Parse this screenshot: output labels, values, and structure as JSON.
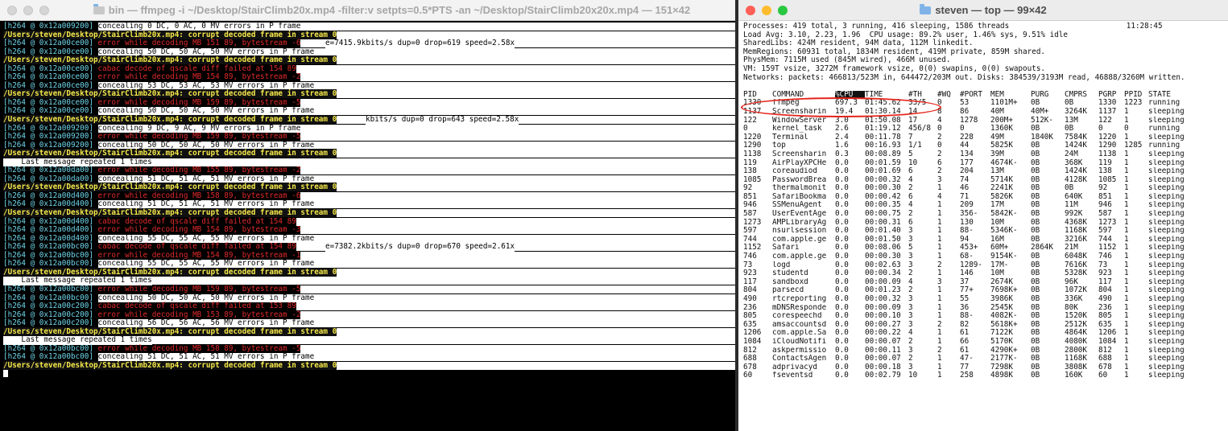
{
  "left_window": {
    "title": "bin — ffmpeg -i ~/Desktop/StairClimb20x.mp4 -filter:v setpts=0.5*PTS -an ~/Desktop/StairClimb20x20x.mp4 — 151×42",
    "lines": [
      {
        "p": "[h264 @ 0x12a009200] ",
        "t": "concealing 0 DC, 0 AC, 0 MV errors in P frame",
        "k": "info",
        "w": 290
      },
      {
        "t": "/Users/steven/Desktop/StairClimb20x.mp4: corrupt decoded frame in stream 0",
        "k": "path",
        "w": 450
      },
      {
        "p": "[h264 @ 0x12a00ce00] ",
        "t": "error while decoding MB 151 89, bytestream -6",
        "k": "err",
        "w": 270,
        "stats": "e=7415.9kbits/s dup=0 drop=619 speed=2.58x"
      },
      {
        "p": "[h264 @ 0x12a00ce00] ",
        "t": "concealing 50 DC, 50 AC, 50 MV errors in P frame",
        "k": "info",
        "w": 290
      },
      {
        "t": "/Users/steven/Desktop/StairClimb20x.mp4: corrupt decoded frame in stream 0",
        "k": "path",
        "w": 450
      },
      {
        "p": "[h264 @ 0x12a00ce00] ",
        "t": "cabac decode of qscale diff failed at 154 89",
        "k": "err",
        "w": 290
      },
      {
        "p": "[h264 @ 0x12a00ce00] ",
        "t": "error while decoding MB 154 89, bytestream -2",
        "k": "err",
        "w": 290
      },
      {
        "p": "[h264 @ 0x12a00ce00] ",
        "t": "concealing 53 DC, 53 AC, 53 MV errors in P frame",
        "k": "info",
        "w": 290
      },
      {
        "t": "/Users/steven/Desktop/StairClimb20x.mp4: corrupt decoded frame in stream 0",
        "k": "path",
        "w": 450
      },
      {
        "p": "[h264 @ 0x12a00ce00] ",
        "t": "error while decoding MB 159 89, bytestream -5",
        "k": "err",
        "w": 290
      },
      {
        "p": "[h264 @ 0x12a00ce00] ",
        "t": "concealing 50 DC, 50 AC, 50 MV errors in P frame",
        "k": "info",
        "w": 290
      },
      {
        "t": "/Users/steven/Desktop/StairClimb20x.mp4: corrupt decoded frame in stream 0",
        "k": "path",
        "w": 450,
        "stats": "kbits/s dup=0 drop=643 speed=2.58x"
      },
      {
        "p": "[h264 @ 0x12a009200] ",
        "t": "concealing 9 DC, 9 AC, 9 MV errors in P frame",
        "k": "info",
        "w": 290
      },
      {
        "p": "[h264 @ 0x12a009200] ",
        "t": "error while decoding MB 159 89, bytestream -5",
        "k": "err",
        "w": 290
      },
      {
        "p": "[h264 @ 0x12a009200] ",
        "t": "concealing 50 DC, 50 AC, 50 MV errors in P frame",
        "k": "info",
        "w": 290
      },
      {
        "t": "/Users/steven/Desktop/StairClimb20x.mp4: corrupt decoded frame in stream 0",
        "k": "path",
        "w": 450
      },
      {
        "t": "    Last message repeated 1 times",
        "k": "rep",
        "w": 200
      },
      {
        "p": "[h264 @ 0x12a00da00] ",
        "t": "error while decoding MB 155 89, bytestream -2",
        "k": "err",
        "w": 290
      },
      {
        "p": "[h264 @ 0x12a00da00] ",
        "t": "concealing 51 DC, 51 AC, 51 MV errors in P frame",
        "k": "info",
        "w": 290
      },
      {
        "t": "/Users/steven/Desktop/StairClimb20x.mp4: corrupt decoded frame in stream 0",
        "k": "path",
        "w": 450
      },
      {
        "p": "[h264 @ 0x12a00d400] ",
        "t": "error while decoding MB 158 89, bytestream -6",
        "k": "err",
        "w": 290
      },
      {
        "p": "[h264 @ 0x12a00d400] ",
        "t": "concealing 51 DC, 51 AC, 51 MV errors in P frame",
        "k": "info",
        "w": 290
      },
      {
        "t": "/Users/steven/Desktop/StairClimb20x.mp4: corrupt decoded frame in stream 0",
        "k": "path",
        "w": 450
      },
      {
        "p": "[h264 @ 0x12a00d400] ",
        "t": "cabac decode of qscale diff failed at 154 89",
        "k": "err",
        "w": 290
      },
      {
        "p": "[h264 @ 0x12a00d400] ",
        "t": "error while decoding MB 154 89, bytestream -3",
        "k": "err",
        "w": 290
      },
      {
        "p": "[h264 @ 0x12a00d400] ",
        "t": "concealing 55 DC, 55 AC, 55 MV errors in P frame",
        "k": "info",
        "w": 290
      },
      {
        "p": "[h264 @ 0x12a00bc00] ",
        "t": "cabac decode of qscale diff failed at 154 89",
        "k": "err",
        "w": 290,
        "stats": "e=7382.2kbits/s dup=0 drop=670 speed=2.61x"
      },
      {
        "p": "[h264 @ 0x12a00bc00] ",
        "t": "error while decoding MB 154 89, bytestream -1",
        "k": "err",
        "w": 290
      },
      {
        "p": "[h264 @ 0x12a00bc00] ",
        "t": "concealing 55 DC, 55 AC, 55 MV errors in P frame",
        "k": "info",
        "w": 290
      },
      {
        "t": "/Users/steven/Desktop/StairClimb20x.mp4: corrupt decoded frame in stream 0",
        "k": "path",
        "w": 450
      },
      {
        "t": "    Last message repeated 1 times",
        "k": "rep",
        "w": 200
      },
      {
        "p": "[h264 @ 0x12a00bc00] ",
        "t": "error while decoding MB 159 89, bytestream -5",
        "k": "err",
        "w": 290
      },
      {
        "p": "[h264 @ 0x12a00bc00] ",
        "t": "concealing 50 DC, 50 AC, 50 MV errors in P frame",
        "k": "info",
        "w": 290
      },
      {
        "p": "[h264 @ 0x12a00c200] ",
        "t": "cabac decode of qscale diff failed at 153 89",
        "k": "err",
        "w": 290
      },
      {
        "p": "[h264 @ 0x12a00c200] ",
        "t": "error while decoding MB 153 89, bytestream -2",
        "k": "err",
        "w": 290
      },
      {
        "p": "[h264 @ 0x12a00c200] ",
        "t": "concealing 56 DC, 56 AC, 56 MV errors in P frame",
        "k": "info",
        "w": 290
      },
      {
        "t": "/Users/steven/Desktop/StairClimb20x.mp4: corrupt decoded frame in stream 0",
        "k": "path",
        "w": 450
      },
      {
        "t": "    Last message repeated 1 times",
        "k": "rep",
        "w": 200
      },
      {
        "p": "[h264 @ 0x12a00bc00] ",
        "t": "error while decoding MB 158 89, bytestream -5",
        "k": "err",
        "w": 290
      },
      {
        "p": "[h264 @ 0x12a00bc00] ",
        "t": "concealing 51 DC, 51 AC, 51 MV errors in P frame",
        "k": "info",
        "w": 290
      },
      {
        "t": "/Users/steven/Desktop/StairClimb20x.mp4: corrupt decoded frame in stream 0",
        "k": "path",
        "w": 450
      }
    ]
  },
  "right_window": {
    "title": "steven — top — 99×42",
    "summary": [
      "Processes: 419 total, 3 running, 416 sleeping, 1586 threads                          11:28:45",
      "Load Avg: 3.10, 2.23, 1.96  CPU usage: 89.2% user, 1.46% sys, 9.51% idle",
      "SharedLibs: 424M resident, 94M data, 112M linkedit.",
      "MemRegions: 60931 total, 1834M resident, 419M private, 859M shared.",
      "PhysMem: 7115M used (845M wired), 466M unused.",
      "VM: 159T vsize, 3272M framework vsize, 0(0) swapins, 0(0) swapouts.",
      "Networks: packets: 466813/523M in, 644472/203M out. Disks: 384539/3193M read, 46888/3260M written."
    ],
    "columns": [
      "PID",
      "COMMAND",
      "%CPU",
      "TIME",
      "#TH",
      "#WQ",
      "#PORT",
      "MEM",
      "PURG",
      "CMPRS",
      "PGRP",
      "PPID",
      "STATE"
    ],
    "rows": [
      [
        "1330",
        "ffmpeg",
        "697.3",
        "01:45.62",
        "33/5",
        "0",
        "53",
        "1101M+",
        "0B",
        "0B",
        "1330",
        "1223",
        "running"
      ],
      [
        "1137",
        "Screensharin",
        "19.4",
        "01:30.14",
        "14",
        "8",
        "86",
        "40M",
        "40M+",
        "3264K",
        "1137",
        "1",
        "sleeping"
      ],
      [
        "122",
        "WindowServer",
        "3.0",
        "01:50.08",
        "17",
        "4",
        "1278",
        "200M+",
        "512K-",
        "13M",
        "122",
        "1",
        "sleeping"
      ],
      [
        "0",
        "kernel_task",
        "2.6",
        "01:19.12",
        "456/8",
        "0",
        "0",
        "1360K",
        "0B",
        "0B",
        "0",
        "0",
        "running"
      ],
      [
        "1220",
        "Terminal",
        "2.4",
        "00:11.78",
        "7",
        "2",
        "228",
        "49M",
        "1840K",
        "7584K",
        "1220",
        "1",
        "sleeping"
      ],
      [
        "1290",
        "top",
        "1.6",
        "00:16.93",
        "1/1",
        "0",
        "44",
        "5825K",
        "0B",
        "1424K",
        "1290",
        "1285",
        "running"
      ],
      [
        "1138",
        "Screensharin",
        "0.3",
        "00:08.89",
        "5",
        "2",
        "134",
        "39M",
        "0B",
        "24M",
        "1138",
        "1",
        "sleeping"
      ],
      [
        "119",
        "AirPlayXPCHe",
        "0.0",
        "00:01.59",
        "10",
        "6",
        "177",
        "4674K-",
        "0B",
        "368K",
        "119",
        "1",
        "sleeping"
      ],
      [
        "138",
        "coreaudiod",
        "0.0",
        "00:01.69",
        "6",
        "2",
        "204",
        "13M",
        "0B",
        "1424K",
        "138",
        "1",
        "sleeping"
      ],
      [
        "1085",
        "PasswordBrea",
        "0.0",
        "00:00.32",
        "4",
        "3",
        "74",
        "5714K",
        "0B",
        "4128K",
        "1085",
        "1",
        "sleeping"
      ],
      [
        "92",
        "thermalmonit",
        "0.0",
        "00:00.30",
        "2",
        "1",
        "46",
        "2241K",
        "0B",
        "0B",
        "92",
        "1",
        "sleeping"
      ],
      [
        "851",
        "SafariBookma",
        "0.0",
        "00:00.42",
        "6",
        "4",
        "71",
        "5826K",
        "0B",
        "640K",
        "851",
        "1",
        "sleeping"
      ],
      [
        "946",
        "SSMenuAgent",
        "0.0",
        "00:00.35",
        "4",
        "1",
        "209",
        "17M",
        "0B",
        "11M",
        "946",
        "1",
        "sleeping"
      ],
      [
        "587",
        "UserEventAge",
        "0.0",
        "00:00.75",
        "2",
        "1",
        "356-",
        "5842K-",
        "0B",
        "992K",
        "587",
        "1",
        "sleeping"
      ],
      [
        "1273",
        "AMPLibraryAg",
        "0.0",
        "00:00.31",
        "6",
        "1",
        "130",
        "10M",
        "0B",
        "4368K",
        "1273",
        "1",
        "sleeping"
      ],
      [
        "597",
        "nsurlsession",
        "0.0",
        "00:01.40",
        "3",
        "1",
        "88-",
        "5346K-",
        "0B",
        "1168K",
        "597",
        "1",
        "sleeping"
      ],
      [
        "744",
        "com.apple.ge",
        "0.0",
        "00:01.50",
        "3",
        "1",
        "94",
        "16M",
        "0B",
        "3216K",
        "744",
        "1",
        "sleeping"
      ],
      [
        "1152",
        "Safari",
        "0.0",
        "00:08.06",
        "5",
        "1",
        "453+",
        "60M+",
        "2864K",
        "21M",
        "1152",
        "1",
        "sleeping"
      ],
      [
        "746",
        "com.apple.ge",
        "0.0",
        "00:00.30",
        "3",
        "1",
        "68-",
        "9154K-",
        "0B",
        "6048K",
        "746",
        "1",
        "sleeping"
      ],
      [
        "73",
        "logd",
        "0.0",
        "00:02.63",
        "3",
        "2",
        "1289-",
        "17M-",
        "0B",
        "7616K",
        "73",
        "1",
        "sleeping"
      ],
      [
        "923",
        "studentd",
        "0.0",
        "00:00.34",
        "2",
        "1",
        "146",
        "10M",
        "0B",
        "5328K",
        "923",
        "1",
        "sleeping"
      ],
      [
        "117",
        "sandboxd",
        "0.0",
        "00:00.09",
        "4",
        "3",
        "37",
        "2674K",
        "0B",
        "96K",
        "117",
        "1",
        "sleeping"
      ],
      [
        "804",
        "parsecd",
        "0.0",
        "00:01.23",
        "2",
        "1",
        "77+",
        "7698K+",
        "0B",
        "1072K",
        "804",
        "1",
        "sleeping"
      ],
      [
        "490",
        "rtcreporting",
        "0.0",
        "00:00.32",
        "3",
        "1",
        "55",
        "3986K",
        "0B",
        "336K",
        "490",
        "1",
        "sleeping"
      ],
      [
        "236",
        "mDNSResponde",
        "0.0",
        "00:00.09",
        "3",
        "1",
        "36",
        "2545K",
        "0B",
        "80K",
        "236",
        "1",
        "sleeping"
      ],
      [
        "805",
        "corespeechd",
        "0.0",
        "00:00.10",
        "3",
        "1",
        "88-",
        "4082K-",
        "0B",
        "1520K",
        "805",
        "1",
        "sleeping"
      ],
      [
        "635",
        "amsaccountsd",
        "0.0",
        "00:00.27",
        "3",
        "2",
        "82",
        "5618K+",
        "0B",
        "2512K",
        "635",
        "1",
        "sleeping"
      ],
      [
        "1206",
        "com.apple.Sa",
        "0.0",
        "00:00.22",
        "4",
        "1",
        "61",
        "7122K",
        "0B",
        "4864K",
        "1206",
        "1",
        "sleeping"
      ],
      [
        "1084",
        "iCloudNotifi",
        "0.0",
        "00:00.07",
        "2",
        "1",
        "66",
        "5170K",
        "0B",
        "4080K",
        "1084",
        "1",
        "sleeping"
      ],
      [
        "812",
        "askpermissio",
        "0.0",
        "00:00.11",
        "3",
        "2",
        "61",
        "4290K+",
        "0B",
        "2800K",
        "812",
        "1",
        "sleeping"
      ],
      [
        "688",
        "ContactsAgen",
        "0.0",
        "00:00.07",
        "2",
        "1",
        "47-",
        "2177K-",
        "0B",
        "1168K",
        "688",
        "1",
        "sleeping"
      ],
      [
        "678",
        "adprivacyd",
        "0.0",
        "00:00.18",
        "3",
        "1",
        "77",
        "7298K",
        "0B",
        "3808K",
        "678",
        "1",
        "sleeping"
      ],
      [
        "60",
        "fseventsd",
        "0.0",
        "00:02.79",
        "10",
        "1",
        "258",
        "4898K",
        "0B",
        "160K",
        "60",
        "1",
        "sleeping"
      ]
    ]
  }
}
